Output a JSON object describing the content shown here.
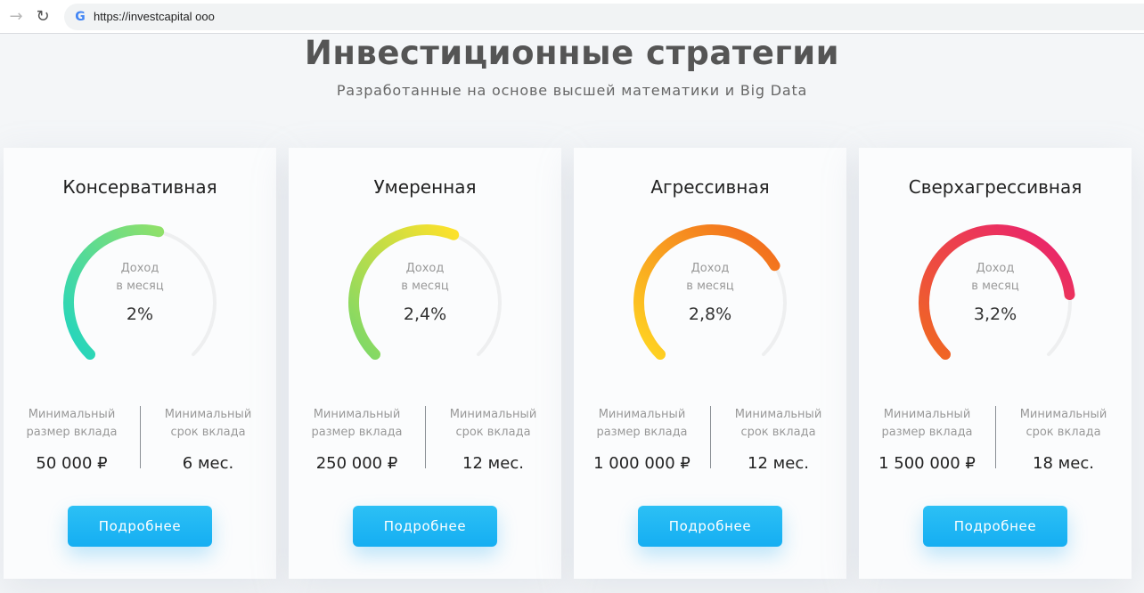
{
  "browser": {
    "url": "https://investcapital ooo"
  },
  "header": {
    "title": "Инвестиционные стратегии",
    "subtitle": "Разработанные на основе высшей математики и Big Data"
  },
  "colors": {
    "accent_button": "#1ab3f3",
    "conservative_gradient": [
      "#1fd5c1",
      "#8fe06a"
    ],
    "moderate_gradient": [
      "#78d86a",
      "#fde12b"
    ],
    "aggressive_gradient": [
      "#ffd722",
      "#f1651e"
    ],
    "superaggressive_gradient": [
      "#f06a20",
      "#e91e73"
    ]
  },
  "gauge_label": "Доход\nв месяц",
  "labels": {
    "min_amount": "Минимальный\nразмер вклада",
    "min_term": "Минимальный\nсрок вклада",
    "more": "Подробнее"
  },
  "cards": [
    {
      "title": "Консервативная",
      "monthly_income": "2%",
      "income_fraction": 0.55,
      "min_amount": "50 000 ₽",
      "min_term": "6 мес."
    },
    {
      "title": "Умеренная",
      "monthly_income": "2,4%",
      "income_fraction": 0.58,
      "min_amount": "250 000 ₽",
      "min_term": "12 мес."
    },
    {
      "title": "Агрессивная",
      "monthly_income": "2,8%",
      "income_fraction": 0.72,
      "min_amount": "1 000 000 ₽",
      "min_term": "12 мес."
    },
    {
      "title": "Сверхагрессивная",
      "monthly_income": "3,2%",
      "income_fraction": 0.81,
      "min_amount": "1 500 000 ₽",
      "min_term": "18 мес."
    }
  ]
}
